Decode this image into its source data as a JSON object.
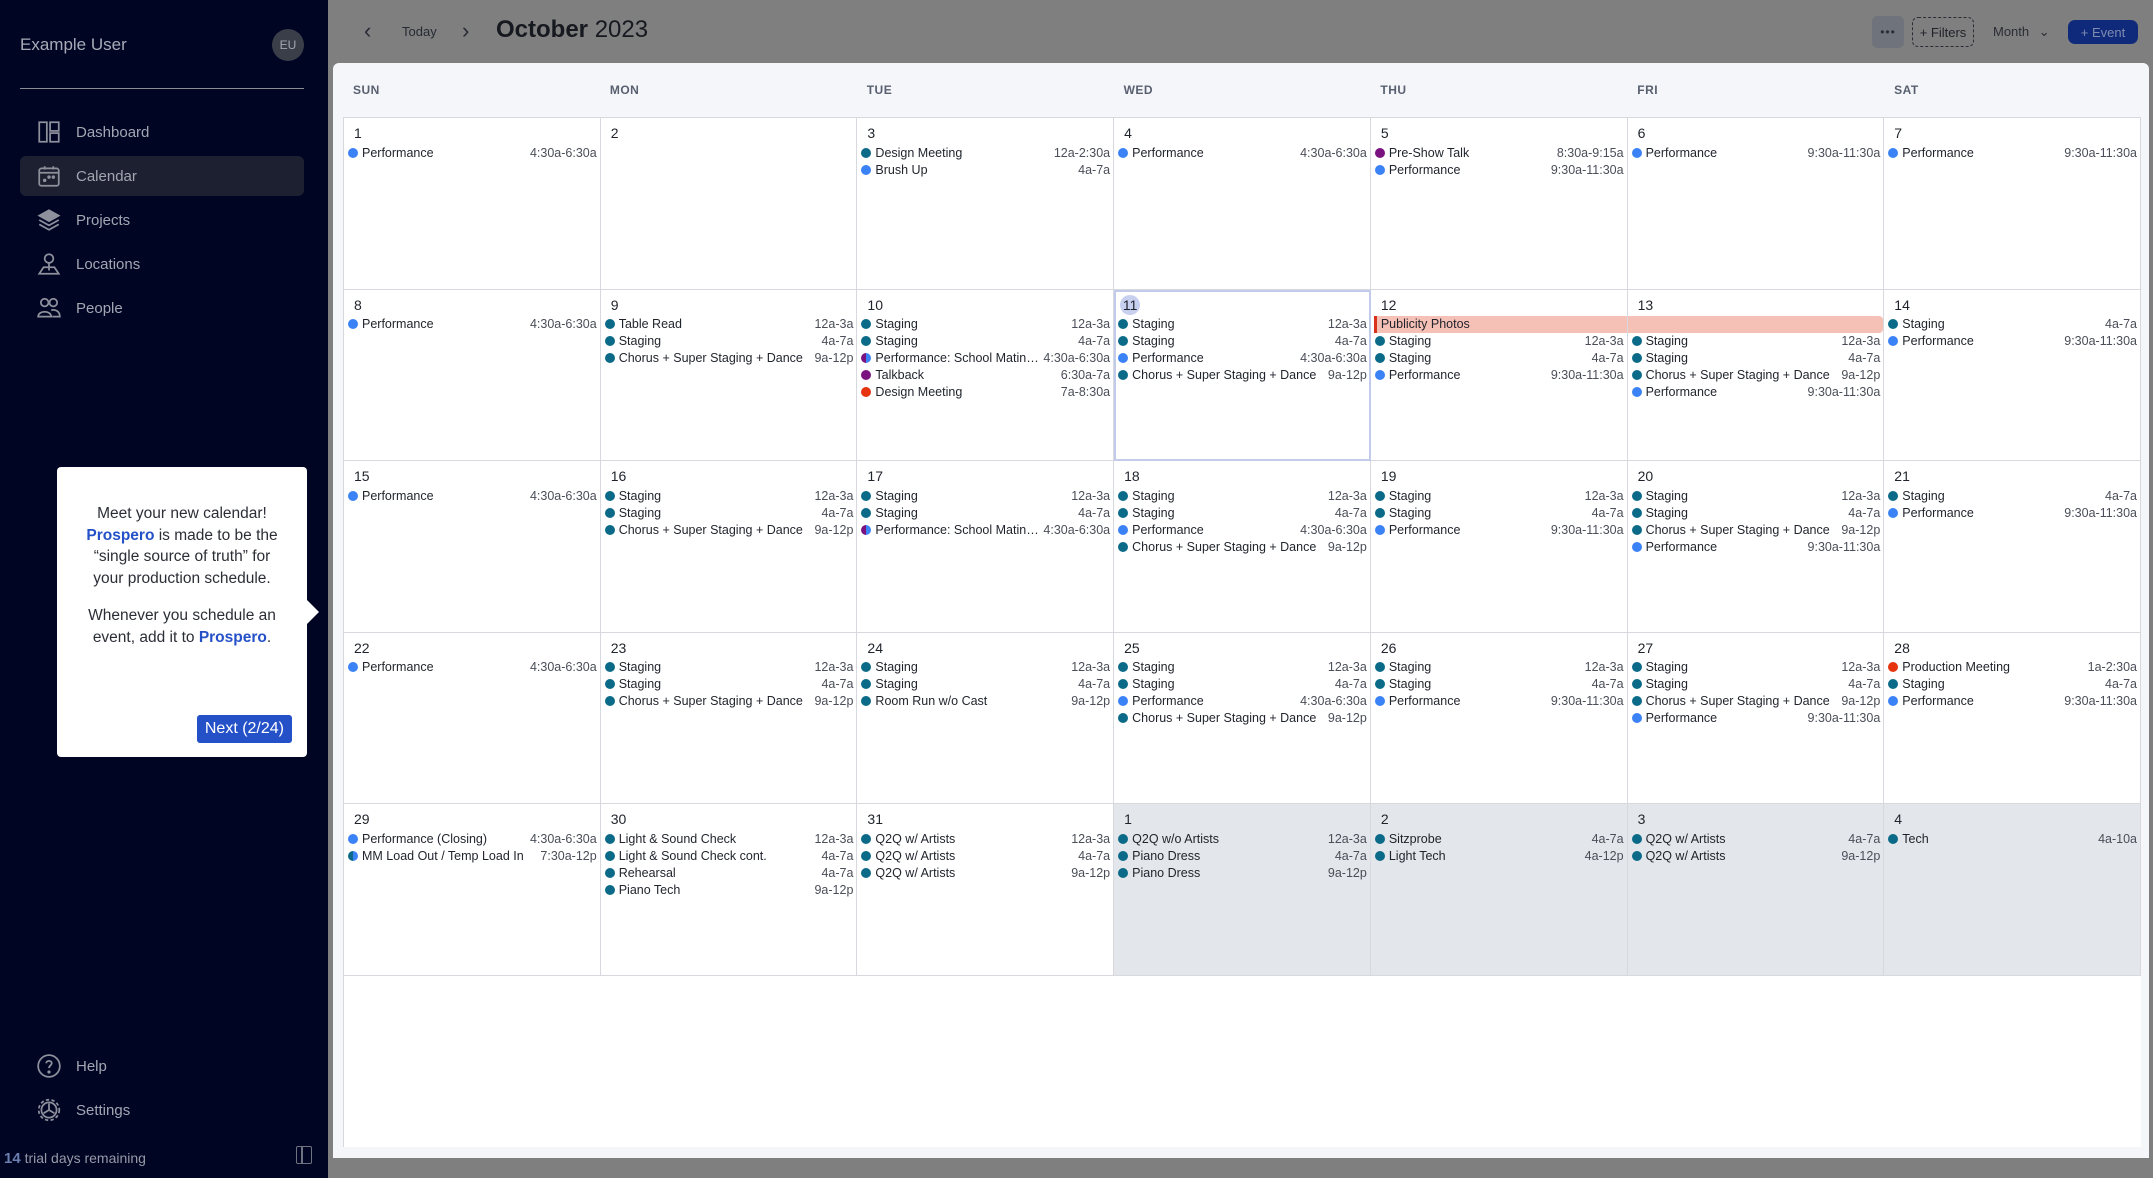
{
  "sidebar": {
    "user_name": "Example User",
    "avatar_initials": "EU",
    "nav": [
      {
        "label": "Dashboard",
        "icon": "dashboard-icon"
      },
      {
        "label": "Calendar",
        "icon": "calendar-icon",
        "active": true
      },
      {
        "label": "Projects",
        "icon": "layers-icon"
      },
      {
        "label": "Locations",
        "icon": "location-pin-icon"
      },
      {
        "label": "People",
        "icon": "people-icon"
      }
    ],
    "bottom_nav": [
      {
        "label": "Help",
        "icon": "help-icon"
      },
      {
        "label": "Settings",
        "icon": "gear-icon"
      }
    ],
    "trial_days": "14",
    "trial_text": "trial days remaining"
  },
  "tour": {
    "line1": "Meet your new calendar!",
    "brand": "Prospero",
    "line2_rest": " is made to be the “single source of truth” for your production schedule.",
    "line3_pre": "Whenever you schedule an event, add it to ",
    "line3_post": ".",
    "next_label": "Next (2/24)"
  },
  "header": {
    "prev_icon": "‹",
    "next_icon": "›",
    "today_label": "Today",
    "month": "October",
    "year": "2023",
    "more_label": "•••",
    "filters_label": "+ Filters",
    "view_label": "Month",
    "view_chevron": "⌄",
    "add_event_label": "+ Event"
  },
  "colors": {
    "teal": "#0b6a88",
    "blue": "#3b82f6",
    "purple": "#7a1380",
    "red": "#e5340e",
    "publicity": "#f5c0b6"
  },
  "weekdays": [
    "SUN",
    "MON",
    "TUE",
    "WED",
    "THU",
    "FRI",
    "SAT"
  ],
  "days": [
    {
      "n": "1",
      "events": [
        {
          "t": "Performance",
          "time": "4:30a-6:30a",
          "c": "blue"
        }
      ]
    },
    {
      "n": "2",
      "events": []
    },
    {
      "n": "3",
      "events": [
        {
          "t": "Design Meeting",
          "time": "12a-2:30a",
          "c": "teal"
        },
        {
          "t": "Brush Up",
          "time": "4a-7a",
          "c": "blue"
        }
      ]
    },
    {
      "n": "4",
      "events": [
        {
          "t": "Performance",
          "time": "4:30a-6:30a",
          "c": "blue"
        }
      ]
    },
    {
      "n": "5",
      "events": [
        {
          "t": "Pre-Show Talk",
          "time": "8:30a-9:15a",
          "c": "purple"
        },
        {
          "t": "Performance",
          "time": "9:30a-11:30a",
          "c": "blue"
        }
      ]
    },
    {
      "n": "6",
      "events": [
        {
          "t": "Performance",
          "time": "9:30a-11:30a",
          "c": "blue"
        }
      ]
    },
    {
      "n": "7",
      "events": [
        {
          "t": "Performance",
          "time": "9:30a-11:30a",
          "c": "blue"
        }
      ]
    },
    {
      "n": "8",
      "events": [
        {
          "t": "Performance",
          "time": "4:30a-6:30a",
          "c": "blue"
        }
      ]
    },
    {
      "n": "9",
      "events": [
        {
          "t": "Table Read",
          "time": "12a-3a",
          "c": "teal"
        },
        {
          "t": "Staging",
          "time": "4a-7a",
          "c": "teal"
        },
        {
          "t": "Chorus + Super Staging + Dance",
          "time": "9a-12p",
          "c": "teal"
        }
      ]
    },
    {
      "n": "10",
      "events": [
        {
          "t": "Staging",
          "time": "12a-3a",
          "c": "teal"
        },
        {
          "t": "Staging",
          "time": "4a-7a",
          "c": "teal"
        },
        {
          "t": "Performance: School Matinee",
          "time": "4:30a-6:30a",
          "c": "split"
        },
        {
          "t": "Talkback",
          "time": "6:30a-7a",
          "c": "purple"
        },
        {
          "t": "Design Meeting",
          "time": "7a-8:30a",
          "c": "red"
        }
      ]
    },
    {
      "n": "11",
      "today": true,
      "events": [
        {
          "t": "Staging",
          "time": "12a-3a",
          "c": "teal"
        },
        {
          "t": "Staging",
          "time": "4a-7a",
          "c": "teal"
        },
        {
          "t": "Performance",
          "time": "4:30a-6:30a",
          "c": "blue"
        },
        {
          "t": "Chorus + Super Staging + Dance",
          "time": "9a-12p",
          "c": "teal"
        }
      ]
    },
    {
      "n": "12",
      "banner": "Publicity Photos",
      "events": [
        {
          "t": "Staging",
          "time": "12a-3a",
          "c": "teal"
        },
        {
          "t": "Staging",
          "time": "4a-7a",
          "c": "teal"
        },
        {
          "t": "Performance",
          "time": "9:30a-11:30a",
          "c": "blue"
        }
      ]
    },
    {
      "n": "13",
      "banner_cont": true,
      "events": [
        {
          "t": "Staging",
          "time": "12a-3a",
          "c": "teal"
        },
        {
          "t": "Staging",
          "time": "4a-7a",
          "c": "teal"
        },
        {
          "t": "Chorus + Super Staging + Dance",
          "time": "9a-12p",
          "c": "teal"
        },
        {
          "t": "Performance",
          "time": "9:30a-11:30a",
          "c": "blue"
        }
      ]
    },
    {
      "n": "14",
      "events": [
        {
          "t": "Staging",
          "time": "4a-7a",
          "c": "teal"
        },
        {
          "t": "Performance",
          "time": "9:30a-11:30a",
          "c": "blue"
        }
      ]
    },
    {
      "n": "15",
      "events": [
        {
          "t": "Performance",
          "time": "4:30a-6:30a",
          "c": "blue"
        }
      ]
    },
    {
      "n": "16",
      "events": [
        {
          "t": "Staging",
          "time": "12a-3a",
          "c": "teal"
        },
        {
          "t": "Staging",
          "time": "4a-7a",
          "c": "teal"
        },
        {
          "t": "Chorus + Super Staging + Dance",
          "time": "9a-12p",
          "c": "teal"
        }
      ]
    },
    {
      "n": "17",
      "events": [
        {
          "t": "Staging",
          "time": "12a-3a",
          "c": "teal"
        },
        {
          "t": "Staging",
          "time": "4a-7a",
          "c": "teal"
        },
        {
          "t": "Performance: School Matinee",
          "time": "4:30a-6:30a",
          "c": "split"
        }
      ]
    },
    {
      "n": "18",
      "events": [
        {
          "t": "Staging",
          "time": "12a-3a",
          "c": "teal"
        },
        {
          "t": "Staging",
          "time": "4a-7a",
          "c": "teal"
        },
        {
          "t": "Performance",
          "time": "4:30a-6:30a",
          "c": "blue"
        },
        {
          "t": "Chorus + Super Staging + Dance",
          "time": "9a-12p",
          "c": "teal"
        }
      ]
    },
    {
      "n": "19",
      "events": [
        {
          "t": "Staging",
          "time": "12a-3a",
          "c": "teal"
        },
        {
          "t": "Staging",
          "time": "4a-7a",
          "c": "teal"
        },
        {
          "t": "Performance",
          "time": "9:30a-11:30a",
          "c": "blue"
        }
      ]
    },
    {
      "n": "20",
      "events": [
        {
          "t": "Staging",
          "time": "12a-3a",
          "c": "teal"
        },
        {
          "t": "Staging",
          "time": "4a-7a",
          "c": "teal"
        },
        {
          "t": "Chorus + Super Staging + Dance",
          "time": "9a-12p",
          "c": "teal"
        },
        {
          "t": "Performance",
          "time": "9:30a-11:30a",
          "c": "blue"
        }
      ]
    },
    {
      "n": "21",
      "events": [
        {
          "t": "Staging",
          "time": "4a-7a",
          "c": "teal"
        },
        {
          "t": "Performance",
          "time": "9:30a-11:30a",
          "c": "blue"
        }
      ]
    },
    {
      "n": "22",
      "events": [
        {
          "t": "Performance",
          "time": "4:30a-6:30a",
          "c": "blue"
        }
      ]
    },
    {
      "n": "23",
      "events": [
        {
          "t": "Staging",
          "time": "12a-3a",
          "c": "teal"
        },
        {
          "t": "Staging",
          "time": "4a-7a",
          "c": "teal"
        },
        {
          "t": "Chorus + Super Staging + Dance",
          "time": "9a-12p",
          "c": "teal"
        }
      ]
    },
    {
      "n": "24",
      "events": [
        {
          "t": "Staging",
          "time": "12a-3a",
          "c": "teal"
        },
        {
          "t": "Staging",
          "time": "4a-7a",
          "c": "teal"
        },
        {
          "t": "Room Run w/o Cast",
          "time": "9a-12p",
          "c": "teal"
        }
      ]
    },
    {
      "n": "25",
      "events": [
        {
          "t": "Staging",
          "time": "12a-3a",
          "c": "teal"
        },
        {
          "t": "Staging",
          "time": "4a-7a",
          "c": "teal"
        },
        {
          "t": "Performance",
          "time": "4:30a-6:30a",
          "c": "blue"
        },
        {
          "t": "Chorus + Super Staging + Dance",
          "time": "9a-12p",
          "c": "teal"
        }
      ]
    },
    {
      "n": "26",
      "events": [
        {
          "t": "Staging",
          "time": "12a-3a",
          "c": "teal"
        },
        {
          "t": "Staging",
          "time": "4a-7a",
          "c": "teal"
        },
        {
          "t": "Performance",
          "time": "9:30a-11:30a",
          "c": "blue"
        }
      ]
    },
    {
      "n": "27",
      "events": [
        {
          "t": "Staging",
          "time": "12a-3a",
          "c": "teal"
        },
        {
          "t": "Staging",
          "time": "4a-7a",
          "c": "teal"
        },
        {
          "t": "Chorus + Super Staging + Dance",
          "time": "9a-12p",
          "c": "teal"
        },
        {
          "t": "Performance",
          "time": "9:30a-11:30a",
          "c": "blue"
        }
      ]
    },
    {
      "n": "28",
      "events": [
        {
          "t": "Production Meeting",
          "time": "1a-2:30a",
          "c": "red"
        },
        {
          "t": "Staging",
          "time": "4a-7a",
          "c": "teal"
        },
        {
          "t": "Performance",
          "time": "9:30a-11:30a",
          "c": "blue"
        }
      ]
    },
    {
      "n": "29",
      "events": [
        {
          "t": "Performance (Closing)",
          "time": "4:30a-6:30a",
          "c": "blue"
        },
        {
          "t": "MM Load Out / Temp Load In",
          "time": "7:30a-12p",
          "c": "splitblue"
        }
      ]
    },
    {
      "n": "30",
      "events": [
        {
          "t": "Light & Sound Check",
          "time": "12a-3a",
          "c": "teal"
        },
        {
          "t": "Light & Sound Check cont.",
          "time": "4a-7a",
          "c": "teal"
        },
        {
          "t": "Rehearsal",
          "time": "4a-7a",
          "c": "teal"
        },
        {
          "t": "Piano Tech",
          "time": "9a-12p",
          "c": "teal"
        }
      ]
    },
    {
      "n": "31",
      "events": [
        {
          "t": "Q2Q w/ Artists",
          "time": "12a-3a",
          "c": "teal"
        },
        {
          "t": "Q2Q w/ Artists",
          "time": "4a-7a",
          "c": "teal"
        },
        {
          "t": "Q2Q w/ Artists",
          "time": "9a-12p",
          "c": "teal"
        }
      ]
    },
    {
      "n": "1",
      "other": true,
      "events": [
        {
          "t": "Q2Q w/o Artists",
          "time": "12a-3a",
          "c": "teal"
        },
        {
          "t": "Piano Dress",
          "time": "4a-7a",
          "c": "teal"
        },
        {
          "t": "Piano Dress",
          "time": "9a-12p",
          "c": "teal"
        }
      ]
    },
    {
      "n": "2",
      "other": true,
      "events": [
        {
          "t": "Sitzprobe",
          "time": "4a-7a",
          "c": "teal"
        },
        {
          "t": "Light Tech",
          "time": "4a-12p",
          "c": "teal"
        }
      ]
    },
    {
      "n": "3",
      "other": true,
      "events": [
        {
          "t": "Q2Q w/ Artists",
          "time": "4a-7a",
          "c": "teal"
        },
        {
          "t": "Q2Q w/ Artists",
          "time": "9a-12p",
          "c": "teal"
        }
      ]
    },
    {
      "n": "4",
      "other": true,
      "events": [
        {
          "t": "Tech",
          "time": "4a-10a",
          "c": "teal"
        }
      ]
    }
  ]
}
